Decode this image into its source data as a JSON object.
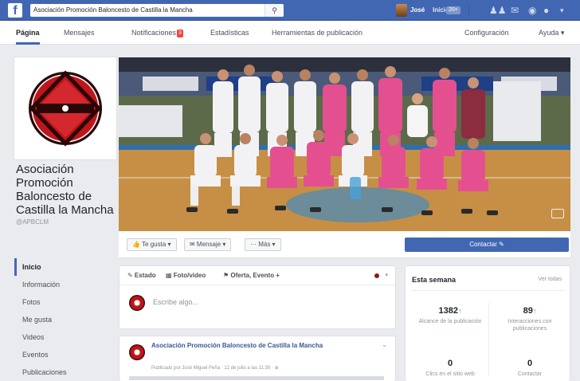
{
  "topbar": {
    "logo": "f",
    "search_value": "Asociación Promoción Baloncesto de Castilla la Mancha",
    "user_name": "José",
    "home_label": "Inicio",
    "home_count": "20+"
  },
  "page_tabs": [
    {
      "label": "Página"
    },
    {
      "label": "Mensajes"
    },
    {
      "label": "Notificaciones",
      "badge": "3"
    },
    {
      "label": "Estadísticas"
    },
    {
      "label": "Herramientas de publicación"
    },
    {
      "label": "Configuración"
    },
    {
      "label": "Ayuda ▾"
    }
  ],
  "profile": {
    "name": "Asociación Promoción Baloncesto de Castilla la Mancha",
    "handle": "@APBCLM",
    "logo_text": "APBCLM",
    "colors": {
      "red": "#c0151b",
      "dark": "#2a0707"
    }
  },
  "nav": [
    "Inicio",
    "Información",
    "Fotos",
    "Me gusta",
    "Videos",
    "Eventos",
    "Publicaciones"
  ],
  "actions": {
    "like": "👍 Te gusta ▾",
    "message": "✉ Mensaje ▾",
    "more": "··· Más ▾",
    "contact": "Contactar ✎"
  },
  "composer": {
    "tabs": [
      "✎ Estado",
      "▦ Foto/video",
      "⚑ Oferta, Evento +"
    ],
    "placeholder": "Escribe algo..."
  },
  "post": {
    "title": "Asociación Promoción Baloncesto de Castilla la Mancha",
    "meta": "Publicado por José Miguel Peña · 12 de julio a las 11:30 · ⊕"
  },
  "week": {
    "title": "Esta semana",
    "link": "Ver todas",
    "stats": [
      {
        "num": "1382",
        "up": true,
        "label": "Alcance de la publicación"
      },
      {
        "num": "89",
        "up": true,
        "label": "Interacciones con publicaciones"
      },
      {
        "num": "0",
        "up": false,
        "label": "Clics en el sitio web"
      },
      {
        "num": "0",
        "up": false,
        "label": "Contactar"
      }
    ]
  },
  "colors": {
    "fb_blue": "#4267b2",
    "pink_jersey": "#e4508f",
    "court": "#c68f45"
  }
}
